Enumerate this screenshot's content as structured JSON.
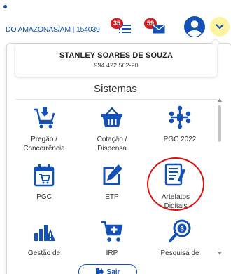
{
  "header": {
    "org_text": "DO AMAZONAS/AM | 154039",
    "notifications": [
      {
        "count": "35",
        "icon": "list-icon"
      },
      {
        "count": "59",
        "icon": "mail-icon"
      }
    ],
    "avatar_icon": "user-circle-icon",
    "toggle_icon": "chevron-down-icon"
  },
  "user": {
    "name": "STANLEY SOARES DE SOUZA",
    "cpf": "994 422 562-20"
  },
  "systems": {
    "title": "Sistemas",
    "items": [
      {
        "label": "Pregão /\nConcorrência",
        "icon": "auction-icon"
      },
      {
        "label": "Cotação /\nDispensa",
        "icon": "basket-icon"
      },
      {
        "label": "PGC 2022",
        "icon": "network-icon"
      },
      {
        "label": "PGC",
        "icon": "calendar-cart-icon"
      },
      {
        "label": "ETP",
        "icon": "edit-icon"
      },
      {
        "label": "Artefatos\nDigitais",
        "icon": "document-pen-icon"
      },
      {
        "label": "Gestão de",
        "icon": "chart-warning-icon"
      },
      {
        "label": "IRP",
        "icon": "cart-plus-icon"
      },
      {
        "label": "Pesquisa de",
        "icon": "price-search-icon"
      }
    ]
  },
  "logout": {
    "label": "Sair",
    "icon": "logout-icon"
  },
  "colors": {
    "primary": "#1351b4",
    "badge": "#d42020",
    "highlight": "#e01010",
    "toggle_bg": "#fff3a0"
  }
}
